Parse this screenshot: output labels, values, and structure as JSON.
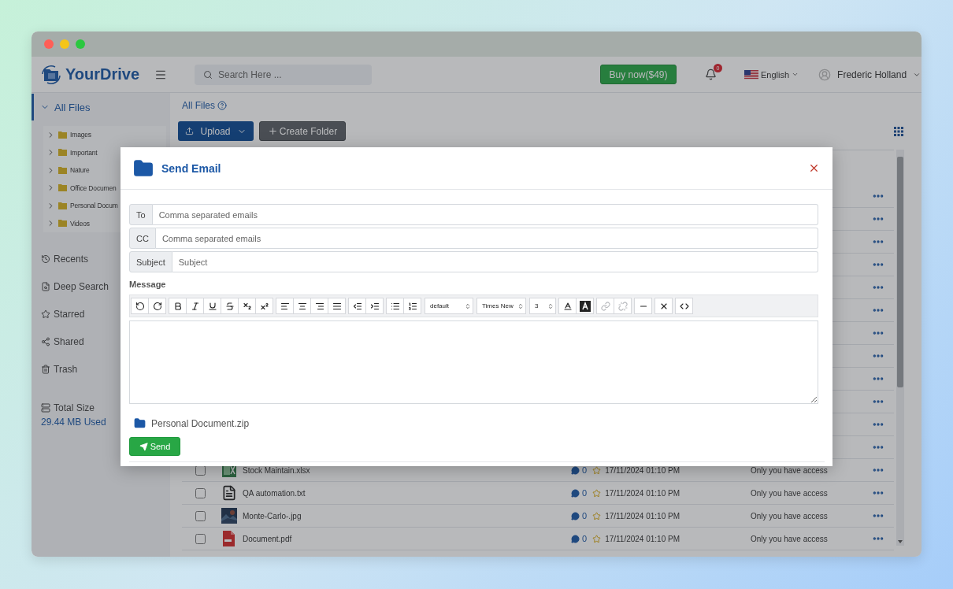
{
  "window": {
    "controls": [
      {
        "color": "#ff5f57"
      },
      {
        "color": "#f5c518"
      },
      {
        "color": "#2bc840"
      }
    ]
  },
  "header": {
    "brand": "YourDrive",
    "search": {
      "placeholder": "Search Here ..."
    },
    "buy_button": "Buy now($49)",
    "notifications": {
      "count": "0"
    },
    "language": "English",
    "user": "Frederic Holland"
  },
  "sidebar": {
    "root": {
      "label": "All Files",
      "expanded": true,
      "selected": true,
      "children": [
        {
          "label": "Images",
          "expanded": false
        },
        {
          "label": "Important",
          "expanded": false
        },
        {
          "label": "Nature",
          "expanded": false
        },
        {
          "label": "Office Documen",
          "expanded": false
        },
        {
          "label": "Personal Docum",
          "expanded": false
        },
        {
          "label": "Videos",
          "expanded": false
        }
      ]
    },
    "nav": [
      {
        "kind": "recent",
        "label": "Recents",
        "selected": false
      },
      {
        "kind": "search",
        "label": "Deep Search",
        "selected": false
      },
      {
        "kind": "star",
        "label": "Starred",
        "selected": false
      },
      {
        "kind": "share",
        "label": "Shared",
        "selected": false
      },
      {
        "kind": "trash",
        "label": "Trash",
        "selected": false
      }
    ],
    "storage": {
      "label": "Total Size",
      "used": "29.44 MB Used"
    }
  },
  "main": {
    "breadcrumb": "All Files",
    "upload_button": "Upload",
    "create_folder_button": "Create Folder"
  },
  "table": {
    "rows": [
      {
        "kind": "covered"
      },
      {
        "kind": "covered"
      },
      {
        "kind": "covered"
      },
      {
        "kind": "covered"
      },
      {
        "kind": "covered"
      },
      {
        "kind": "covered"
      },
      {
        "kind": "covered"
      },
      {
        "kind": "covered"
      },
      {
        "kind": "covered"
      },
      {
        "kind": "covered"
      },
      {
        "kind": "covered"
      },
      {
        "kind": "covered"
      },
      {
        "kind": "spreadsheet",
        "name": "Stock Maintain.xlsx",
        "checked": false,
        "comments": "0",
        "starred": false,
        "date": "17/11/2024 01:10 PM",
        "access": "Only you have access"
      },
      {
        "kind": "text",
        "name": "QA automation.txt",
        "checked": false,
        "comments": "0",
        "starred": false,
        "date": "17/11/2024 01:10 PM",
        "access": "Only you have access"
      },
      {
        "name": "Monte-Carlo-.jpg",
        "checked": false,
        "comments": "0",
        "starred": false,
        "date": "17/11/2024 01:10 PM",
        "access": "Only you have access"
      },
      {
        "kind": "pdf",
        "name": "Document.pdf",
        "checked": false,
        "comments": "0",
        "starred": false,
        "date": "17/11/2024 01:10 PM",
        "access": "Only you have access"
      }
    ]
  },
  "modal": {
    "title": "Send Email",
    "fields": [
      {
        "label": "To",
        "placeholder": "Comma separated emails"
      },
      {
        "label": "CC",
        "placeholder": "Comma separated emails"
      },
      {
        "label": "Subject",
        "placeholder": "Subject"
      }
    ],
    "message_label": "Message",
    "toolbar": {
      "selects": [
        {
          "value": "default"
        },
        {
          "value": "Times New"
        },
        {
          "value": "3"
        }
      ],
      "link_disabled": true
    },
    "attachment": "Personal Document.zip",
    "send_button": "Send"
  }
}
